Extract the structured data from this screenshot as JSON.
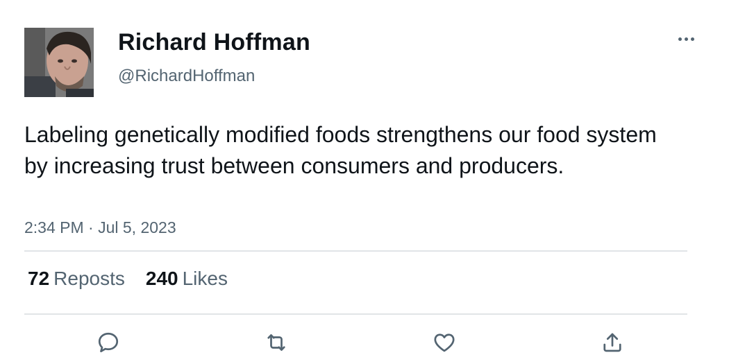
{
  "author": {
    "display_name": "Richard Hoffman",
    "handle": "@RichardHoffman"
  },
  "tweet": {
    "text": "Labeling genetically modified foods strengthens our food system by increasing trust between consumers and producers.",
    "timestamp": "2:34 PM · Jul 5, 2023"
  },
  "stats": {
    "reposts_count": "72",
    "reposts_label": "Reposts",
    "likes_count": "240",
    "likes_label": "Likes"
  },
  "icons": {
    "more": "more-horizontal-icon",
    "reply": "reply-icon",
    "repost": "repost-icon",
    "like": "heart-icon",
    "share": "share-icon"
  },
  "colors": {
    "text": "#0f1419",
    "secondary": "#536471",
    "divider": "#e1e4e7"
  }
}
